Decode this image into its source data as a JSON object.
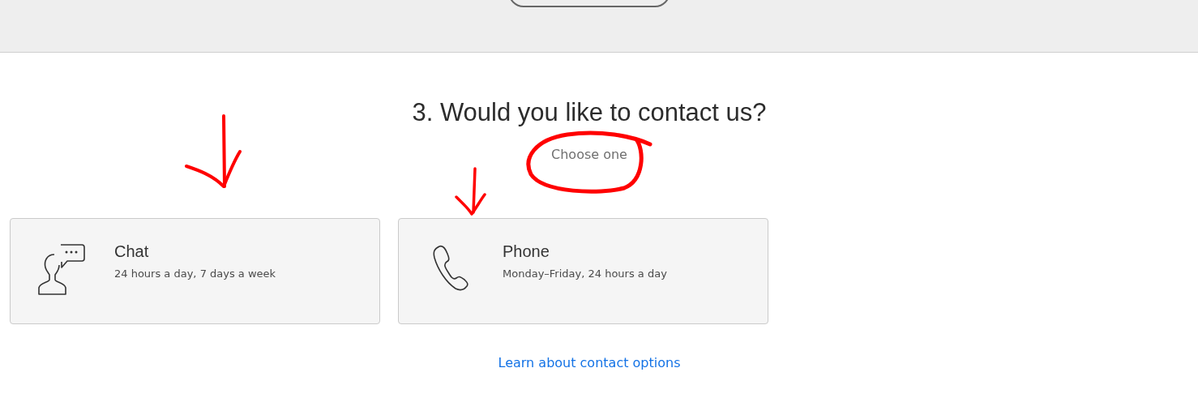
{
  "heading": "3. Would you like to contact us?",
  "subheading": "Choose one",
  "contact_options": [
    {
      "kind": "chat",
      "title": "Chat",
      "subtitle": "24 hours a day, 7 days a week"
    },
    {
      "kind": "phone",
      "title": "Phone",
      "subtitle": "Monday–Friday, 24 hours a day"
    }
  ],
  "link": "Learn about contact options"
}
